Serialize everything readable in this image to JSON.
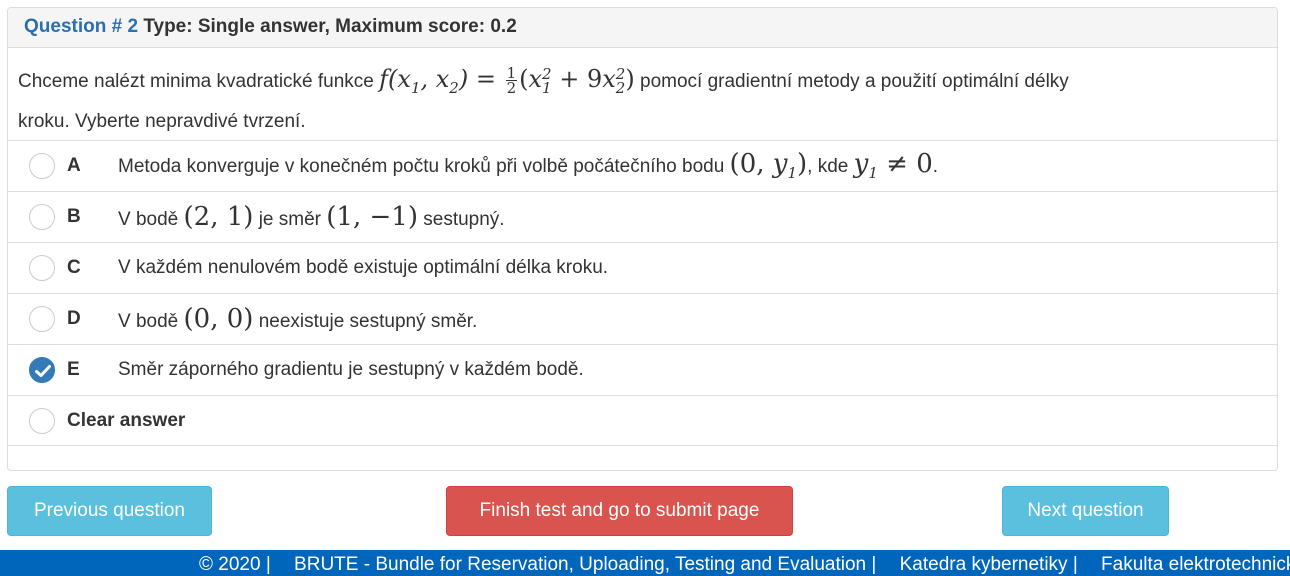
{
  "question": {
    "number_label": "Question # 2",
    "type_label": "Type: Single answer, Maximum score: 0.2",
    "text_before": "Chceme nalézt minima kvadratické funkce",
    "text_after_1": "pomocí gradientní metody a použití optimální délky",
    "text_after_2": "kroku. Vyberte nepravdivé tvrzení."
  },
  "options": [
    {
      "letter": "A",
      "parts": [
        "Metoda konverguje v konečném počtu kroků při volbě počátečního bodu",
        "(0, y",
        "1",
        ")",
        ", kde",
        "y",
        "1",
        "≠ 0",
        "."
      ],
      "checked": false
    },
    {
      "letter": "B",
      "parts": [
        "V bodě",
        "(2, 1)",
        "je směr",
        "(1, −1)",
        "sestupný."
      ],
      "checked": false
    },
    {
      "letter": "C",
      "parts": [
        "V každém nenulovém bodě existuje optimální délka kroku."
      ],
      "checked": false
    },
    {
      "letter": "D",
      "parts": [
        "V bodě",
        "(0, 0)",
        "neexistuje sestupný směr."
      ],
      "checked": false
    },
    {
      "letter": "E",
      "parts": [
        "Směr záporného gradientu je sestupný v každém bodě."
      ],
      "checked": true
    }
  ],
  "clear_answer_label": "Clear answer",
  "buttons": {
    "previous": "Previous question",
    "finish": "Finish test and go to submit page",
    "next": "Next question"
  },
  "footer": {
    "copyright": "© 2020 |",
    "brute": "BRUTE - Bundle for Reservation, Uploading, Testing and Evaluation |",
    "dept": "Katedra kybernetiky |",
    "faculty": "Fakulta elektrotechnická"
  },
  "colors": {
    "accent": "#337ab7",
    "info": "#5bc0de",
    "danger": "#d9534f",
    "footer": "#0066bb"
  }
}
